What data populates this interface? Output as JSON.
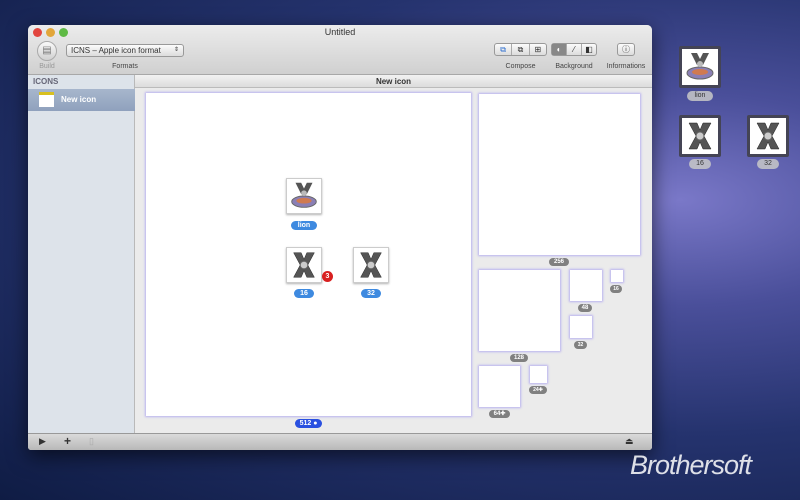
{
  "window": {
    "title": "Untitled"
  },
  "toolbar": {
    "build_label": "Build",
    "format_value": "ICNS – Apple icon format",
    "formats_label": "Formats",
    "compose_label": "Compose",
    "background_label": "Background",
    "informations_label": "Informations"
  },
  "sidebar": {
    "header": "ICONS",
    "items": [
      {
        "label": "New icon"
      }
    ]
  },
  "main": {
    "title": "New icon",
    "canvas_icons": [
      {
        "label": "lion"
      },
      {
        "label": "16",
        "badge": "3"
      },
      {
        "label": "32"
      }
    ],
    "canvas_size": "512",
    "previews": [
      "256",
      "128",
      "48",
      "16",
      "32",
      "64",
      "24"
    ]
  },
  "desktop": {
    "icons": [
      {
        "label": "lion"
      },
      {
        "label": "16"
      },
      {
        "label": "32"
      }
    ]
  },
  "watermark": "Brothersoft"
}
